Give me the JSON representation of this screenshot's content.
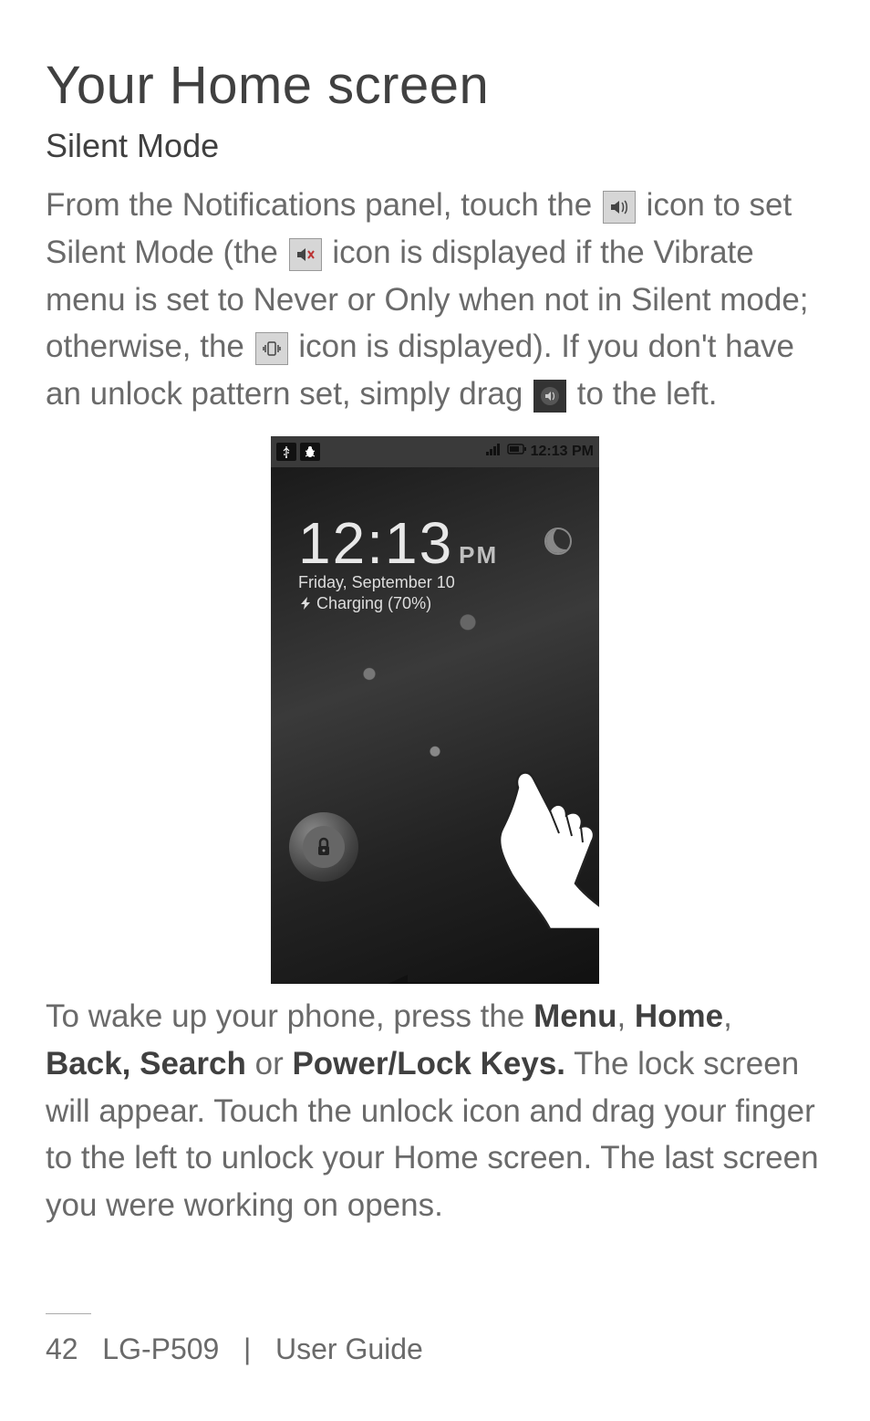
{
  "page": {
    "title": "Your Home screen",
    "section_heading": "Silent Mode",
    "body_part1a": "From the Notifications panel, touch the ",
    "body_part1b": " icon to set Silent Mode (the ",
    "body_part1c": " icon is displayed if the Vibrate menu is set to Never or Only when not in Silent mode; otherwise, the ",
    "body_part1d": " icon is displayed). If you don't have an unlock pattern set, simply drag ",
    "body_part1e": " to the left.",
    "body_part2a": "To wake up your phone, press the ",
    "bold_menu": "Menu",
    "comma_sep": ", ",
    "bold_home": "Home",
    "bold_back_search": "Back, Search",
    "or_sep": " or ",
    "bold_power": "Power/Lock Keys.",
    "body_part2b": " The lock screen will appear. Touch the unlock icon and drag your finger to the left to unlock your Home screen. The last screen you were working on opens."
  },
  "lockscreen": {
    "status_time": "12:13 PM",
    "clock_time": "12:13",
    "clock_pm": "PM",
    "clock_date": "Friday, September 10",
    "clock_charge": "Charging (70%)"
  },
  "footer": {
    "page_num": "42",
    "model": "LG-P509",
    "divider": "|",
    "guide": "User Guide"
  }
}
